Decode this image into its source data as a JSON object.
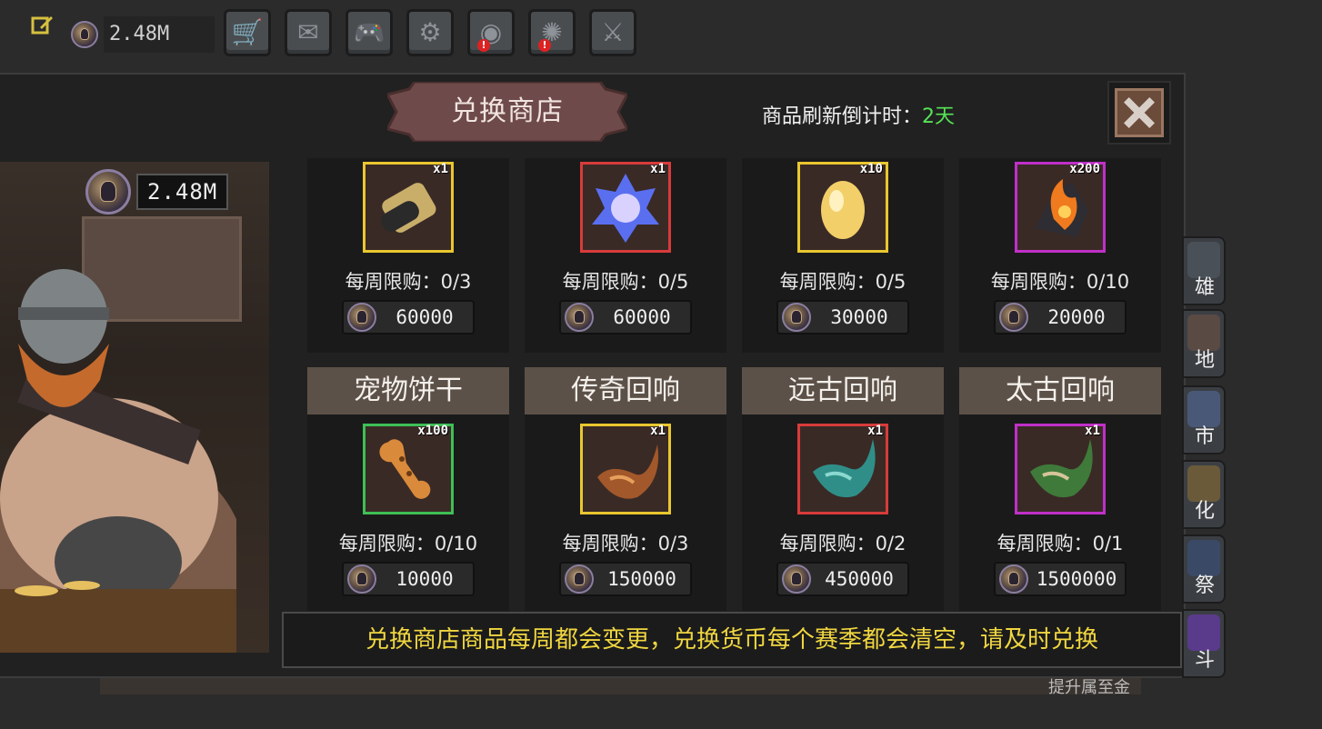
{
  "topbar": {
    "currency_value": "2.48M",
    "buttons": [
      {
        "name": "shop-cart-button",
        "icon": "cart-icon",
        "glyph": "🛒",
        "alert": false
      },
      {
        "name": "mail-button",
        "icon": "mail-icon",
        "glyph": "✉",
        "alert": false
      },
      {
        "name": "gamepad-button",
        "icon": "gamepad-icon",
        "glyph": "🎮",
        "alert": false
      },
      {
        "name": "settings-button",
        "icon": "gear-icon",
        "glyph": "⚙",
        "alert": false
      },
      {
        "name": "color-wheel-button",
        "icon": "color-wheel-icon",
        "glyph": "◉",
        "alert": true
      },
      {
        "name": "fireworks-button",
        "icon": "fireworks-icon",
        "glyph": "✺",
        "alert": true
      },
      {
        "name": "battle-button",
        "icon": "crossed-swords-icon",
        "glyph": "⚔",
        "alert": false
      }
    ],
    "alert_mark": "!"
  },
  "shop": {
    "title": "兑换商店",
    "refresh_label": "商品刷新倒计时：",
    "refresh_value": "2天",
    "currency_value": "2.48M",
    "notice": "兑换商店商品每周都会变更，兑换货币每个赛季都会清空，请及时兑换"
  },
  "items": [
    {
      "header": "",
      "qty": "x1",
      "limit": "每周限购：0/3",
      "price": "60000",
      "rarity_color": "#e9c72f",
      "icon": "scroll-icon"
    },
    {
      "header": "",
      "qty": "x1",
      "limit": "每周限购：0/5",
      "price": "60000",
      "rarity_color": "#d83b3b",
      "icon": "blue-crystal-icon"
    },
    {
      "header": "",
      "qty": "x10",
      "limit": "每周限购：0/5",
      "price": "30000",
      "rarity_color": "#e9c72f",
      "icon": "golden-egg-icon"
    },
    {
      "header": "",
      "qty": "x200",
      "limit": "每周限购：0/10",
      "price": "20000",
      "rarity_color": "#c030c8",
      "icon": "flame-ore-icon"
    },
    {
      "header": "宠物饼干",
      "qty": "x100",
      "limit": "每周限购：0/10",
      "price": "10000",
      "rarity_color": "#3fbf55",
      "icon": "dog-biscuit-icon"
    },
    {
      "header": "传奇回响",
      "qty": "x1",
      "limit": "每周限购：0/3",
      "price": "150000",
      "rarity_color": "#e9c72f",
      "icon": "horn-orange-icon"
    },
    {
      "header": "远古回响",
      "qty": "x1",
      "limit": "每周限购：0/2",
      "price": "450000",
      "rarity_color": "#d83b3b",
      "icon": "horn-teal-icon"
    },
    {
      "header": "太古回响",
      "qty": "x1",
      "limit": "每周限购：0/1",
      "price": "1500000",
      "rarity_color": "#c030c8",
      "icon": "horn-green-icon"
    }
  ],
  "side_menu": [
    {
      "label": "雄",
      "icon": "hero-helmet-icon"
    },
    {
      "label": "地",
      "icon": "tower-icon"
    },
    {
      "label": "市",
      "icon": "market-icon"
    },
    {
      "label": "化",
      "icon": "ornament-icon"
    },
    {
      "label": "祭",
      "icon": "altar-icon"
    },
    {
      "label": "斗",
      "icon": "portal-icon"
    }
  ],
  "bottom_text": "提升属至金"
}
